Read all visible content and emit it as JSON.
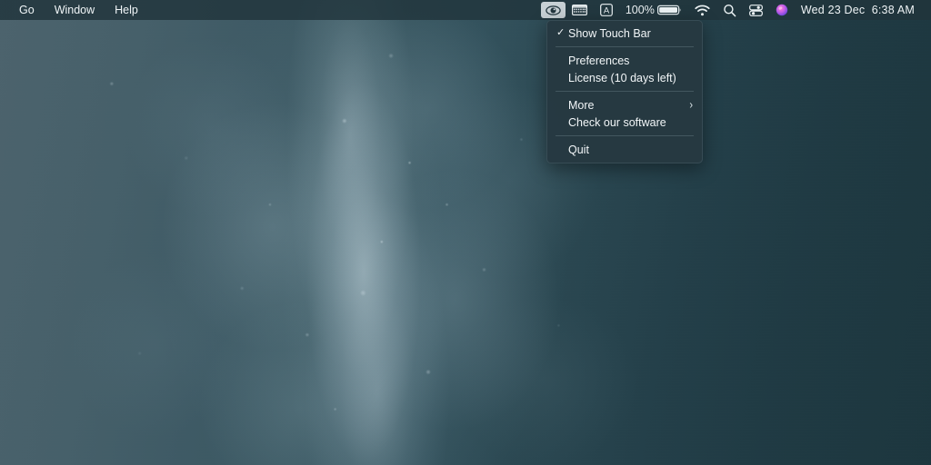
{
  "menubar": {
    "left_menus": [
      {
        "label": "Go"
      },
      {
        "label": "Window"
      },
      {
        "label": "Help"
      }
    ],
    "status_items": [
      {
        "name": "eye-icon",
        "icon": "eye-icon",
        "active": true
      },
      {
        "name": "keyboard-icon",
        "icon": "keyboard-icon",
        "active": false
      },
      {
        "name": "input-source-icon",
        "icon": "letter-a-icon",
        "label": "A",
        "active": false
      }
    ],
    "battery": {
      "percent_label": "100%",
      "level": 100
    },
    "wifi_icon": "wifi-icon",
    "search_icon": "search-icon",
    "control_center_icon": "control-center-icon",
    "siri_icon": "siri-icon",
    "clock": "Wed 23 Dec  6:38 AM"
  },
  "dropdown": {
    "items": [
      {
        "label": "Show Touch Bar",
        "checked": true,
        "check_glyph": "✓",
        "submenu": false
      },
      {
        "type": "separator"
      },
      {
        "label": "Preferences",
        "checked": false,
        "submenu": false
      },
      {
        "label": "License (10 days left)",
        "checked": false,
        "submenu": false
      },
      {
        "type": "separator"
      },
      {
        "label": "More",
        "checked": false,
        "submenu": true,
        "arrow_glyph": "›"
      },
      {
        "label": "Check our software",
        "checked": false,
        "submenu": false
      },
      {
        "type": "separator"
      },
      {
        "label": "Quit",
        "checked": false,
        "submenu": false
      }
    ]
  },
  "desktop": {
    "wallpaper_name": "water-bubbles-wallpaper",
    "colors": {
      "left_slate": "#4c636d",
      "right_teal": "#1c363e",
      "highlight": "#c8dae2",
      "menubar": "#21343c",
      "menu_panel": "#263941"
    }
  }
}
